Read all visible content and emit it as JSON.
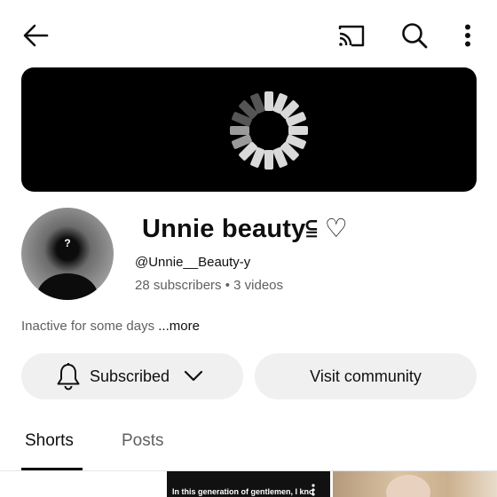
{
  "channel": {
    "name": "Unnie beauty⫅ ♡",
    "handle": "@Unnie__Beauty-y",
    "subscribers": "28 subscribers",
    "separator": "•",
    "videos": "3 videos",
    "description": "Inactive for some days",
    "more_label": "...more",
    "avatar_glyph": "?"
  },
  "actions": {
    "subscribed_label": "Subscribed",
    "visit_label": "Visit community"
  },
  "tabs": [
    {
      "label": "Shorts",
      "selected": true
    },
    {
      "label": "Posts",
      "selected": false
    }
  ],
  "thumbnails": [
    {
      "caption": "In this generation of gentlemen, I kno"
    }
  ],
  "icons": [
    "arrow-back-icon",
    "cast-icon",
    "search-icon",
    "more-vert-icon",
    "bell-icon",
    "chevron-down-icon",
    "loading-spinner-icon"
  ],
  "colors": {
    "text": "#0f0f0f",
    "secondary_text": "#606060",
    "pill_bg": "#f0f0f0",
    "banner_bg": "#000000"
  }
}
